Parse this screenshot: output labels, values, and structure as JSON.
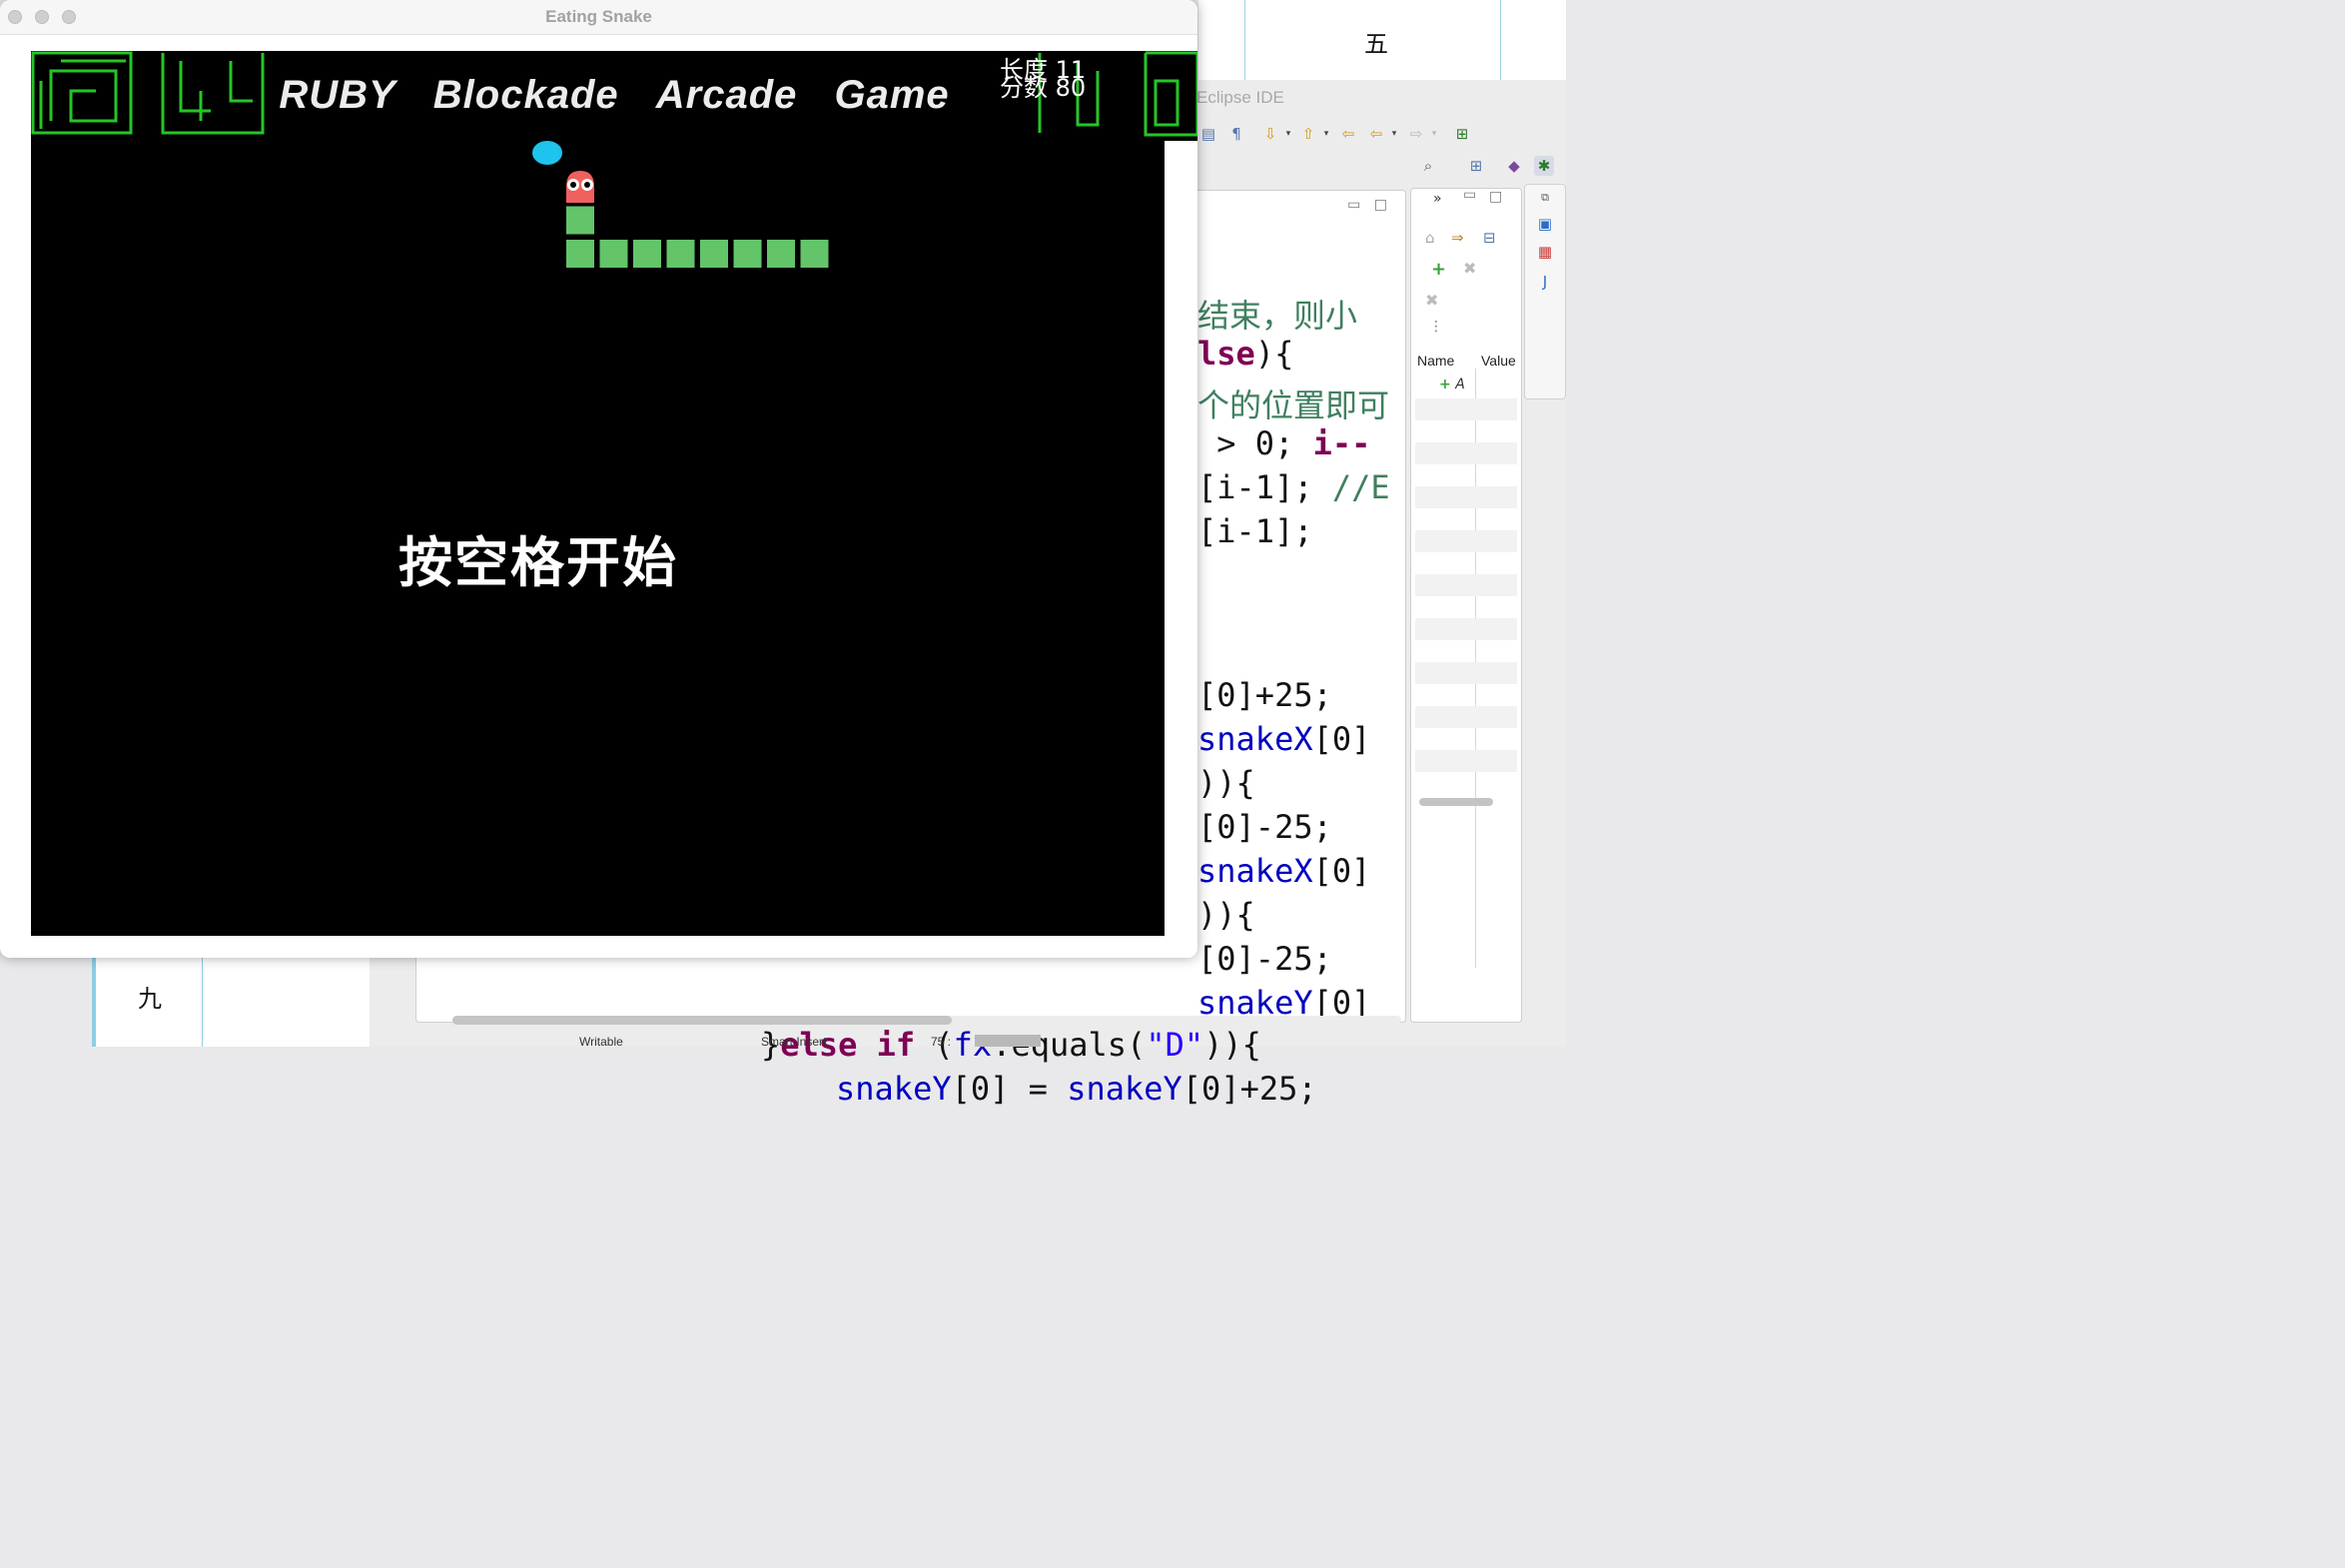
{
  "background": {
    "doc_top_char": "五",
    "doc_bottom_char": "九"
  },
  "eclipse": {
    "title": "Eclipse IDE",
    "variables_view": {
      "col_name": "Name",
      "col_value": "Value",
      "add_row": "A"
    },
    "code_lines": [
      {
        "segments": [
          {
            "t": "结束，则小",
            "c": "cmt"
          }
        ]
      },
      {
        "segments": [
          {
            "t": "lse",
            "c": "kw"
          },
          {
            "t": "){",
            "c": ""
          }
        ]
      },
      {
        "segments": [
          {
            "t": "个的位置即可",
            "c": "cmt"
          }
        ]
      },
      {
        "segments": [
          {
            "t": " > 0; ",
            "c": ""
          },
          {
            "t": "i--",
            "c": "kw"
          }
        ]
      },
      {
        "segments": [
          {
            "t": "[i-1]; ",
            "c": ""
          },
          {
            "t": "//E",
            "c": "cmt"
          }
        ]
      },
      {
        "segments": [
          {
            "t": "[i-1];",
            "c": ""
          }
        ]
      },
      {
        "segments": [
          {
            "t": "",
            "c": ""
          }
        ]
      },
      {
        "segments": [
          {
            "t": "",
            "c": ""
          }
        ]
      },
      {
        "segments": [
          {
            "t": "[0]+25;",
            "c": ""
          }
        ]
      },
      {
        "segments": [
          {
            "t": "snakeX",
            "c": "var"
          },
          {
            "t": "[0]",
            "c": ""
          }
        ]
      },
      {
        "segments": [
          {
            "t": ")){",
            "c": ""
          }
        ]
      },
      {
        "segments": [
          {
            "t": "[0]-25;",
            "c": ""
          }
        ]
      },
      {
        "segments": [
          {
            "t": "snakeX",
            "c": "var"
          },
          {
            "t": "[0]",
            "c": ""
          }
        ]
      },
      {
        "segments": [
          {
            "t": ")){",
            "c": ""
          }
        ]
      },
      {
        "segments": [
          {
            "t": "[0]-25;",
            "c": ""
          }
        ]
      },
      {
        "segments": [
          {
            "t": "snakeY",
            "c": "var"
          },
          {
            "t": "[0]",
            "c": ""
          }
        ]
      }
    ],
    "bottom_line": {
      "segments": [
        {
          "t": "}",
          "c": ""
        },
        {
          "t": "else if",
          "c": "kw"
        },
        {
          "t": " (",
          "c": ""
        },
        {
          "t": "fx",
          "c": "var"
        },
        {
          "t": ".equals(",
          "c": ""
        },
        {
          "t": "\"D\"",
          "c": "str"
        },
        {
          "t": ")){",
          "c": ""
        }
      ]
    },
    "bottom_line2": {
      "segments": [
        {
          "t": "snakeY",
          "c": "var"
        },
        {
          "t": "[0] = ",
          "c": ""
        },
        {
          "t": "snakeY",
          "c": "var"
        },
        {
          "t": "[0]+25;",
          "c": ""
        }
      ]
    },
    "status": {
      "writable": "Writable",
      "insert_mode": "Smart Insert",
      "position": "75 : "
    }
  },
  "snake_window": {
    "title": "Eating Snake",
    "banner_words": [
      "RUBY",
      "Blockade",
      "Arcade",
      "Game"
    ],
    "length_label": "长度",
    "length_value": "11",
    "score_label": "分数",
    "score_value": "80",
    "start_hint": "按空格开始",
    "colors": {
      "body": "#63c46a",
      "head": "#f0605e",
      "food": "#1ec3ee",
      "maze": "#27c427"
    },
    "snake": {
      "segments": 11,
      "direction": "up"
    }
  }
}
